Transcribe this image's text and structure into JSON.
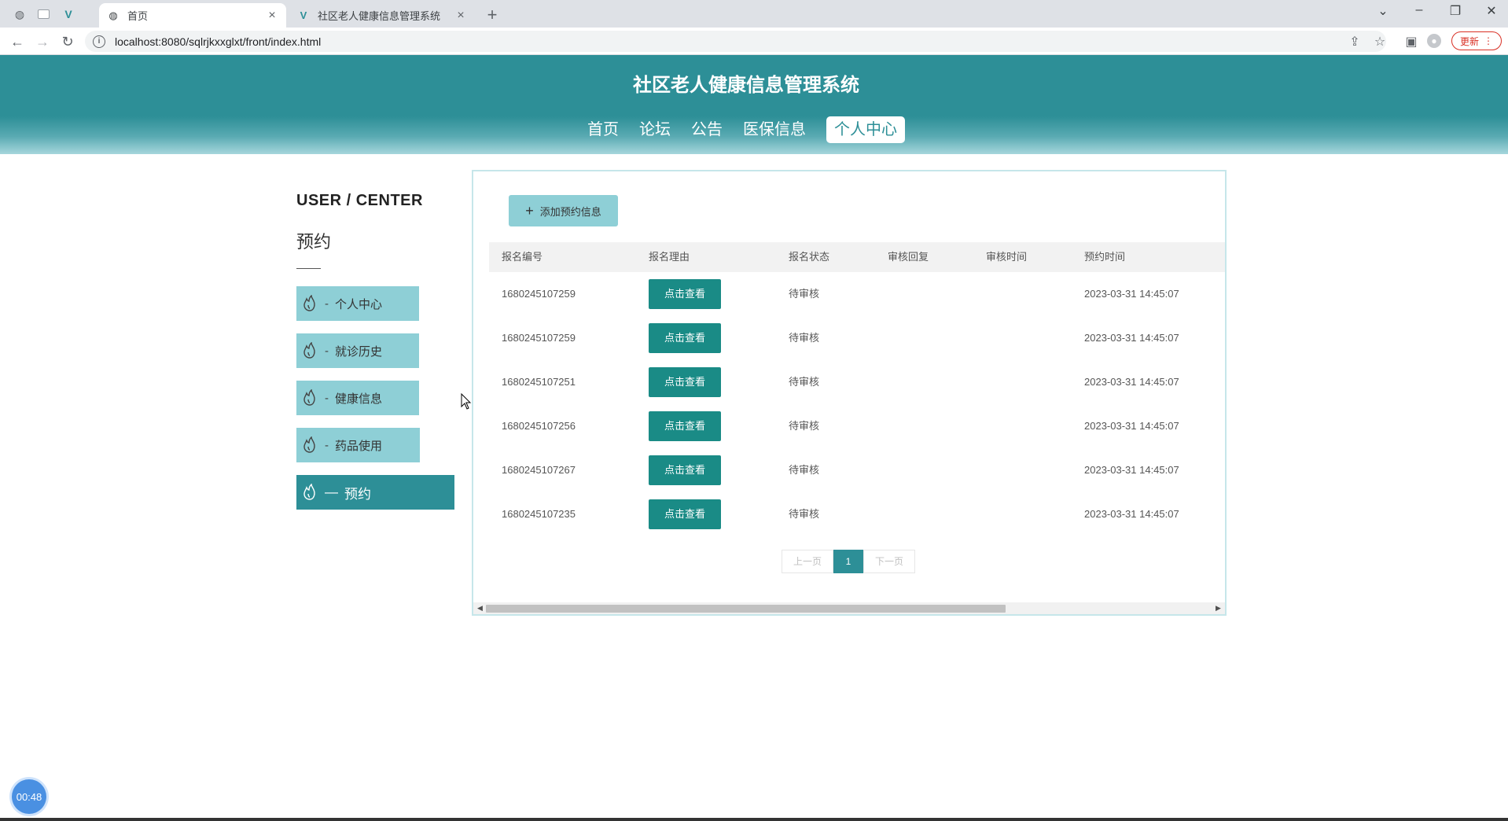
{
  "browser": {
    "tabs": [
      {
        "title": "首页",
        "active": true
      },
      {
        "title": "社区老人健康信息管理系统",
        "active": false
      }
    ],
    "url": "localhost:8080/sqlrjkxxglxt/front/index.html",
    "update_label": "更新"
  },
  "site": {
    "title": "社区老人健康信息管理系统",
    "nav": [
      {
        "label": "首页",
        "active": false
      },
      {
        "label": "论坛",
        "active": false
      },
      {
        "label": "公告",
        "active": false
      },
      {
        "label": "医保信息",
        "active": false
      },
      {
        "label": "个人中心",
        "active": true
      }
    ]
  },
  "sidebar": {
    "heading": "USER / CENTER",
    "subheading": "预约",
    "items": [
      {
        "label": "个人中心",
        "active": false
      },
      {
        "label": "就诊历史",
        "active": false
      },
      {
        "label": "健康信息",
        "active": false
      },
      {
        "label": "药品使用",
        "active": false
      },
      {
        "label": "预约",
        "active": true
      }
    ]
  },
  "content": {
    "add_button_label": "添加预约信息",
    "columns": [
      "报名编号",
      "报名理由",
      "报名状态",
      "审核回复",
      "审核时间",
      "预约时间"
    ],
    "view_button_label": "点击查看",
    "rows": [
      {
        "id": "1680245107259",
        "status": "待审核",
        "reply": "",
        "review_time": "",
        "appt_time": "2023-03-31 14:45:07"
      },
      {
        "id": "1680245107259",
        "status": "待审核",
        "reply": "",
        "review_time": "",
        "appt_time": "2023-03-31 14:45:07"
      },
      {
        "id": "1680245107251",
        "status": "待审核",
        "reply": "",
        "review_time": "",
        "appt_time": "2023-03-31 14:45:07"
      },
      {
        "id": "1680245107256",
        "status": "待审核",
        "reply": "",
        "review_time": "",
        "appt_time": "2023-03-31 14:45:07"
      },
      {
        "id": "1680245107267",
        "status": "待审核",
        "reply": "",
        "review_time": "",
        "appt_time": "2023-03-31 14:45:07"
      },
      {
        "id": "1680245107235",
        "status": "待审核",
        "reply": "",
        "review_time": "",
        "appt_time": "2023-03-31 14:45:07"
      }
    ],
    "pager": {
      "prev": "上一页",
      "current": "1",
      "next": "下一页"
    }
  },
  "timer": "00:48"
}
